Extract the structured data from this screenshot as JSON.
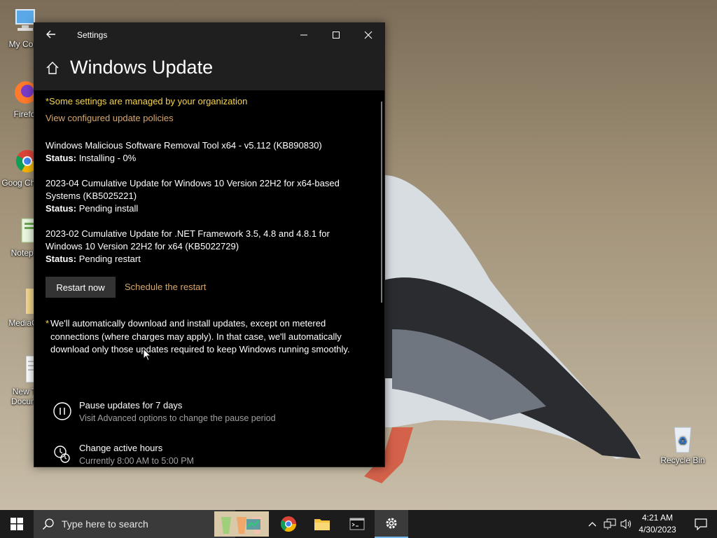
{
  "desktop": {
    "icons": [
      {
        "label": "My Com"
      },
      {
        "label": "Firefo"
      },
      {
        "label": "Goog Chron"
      },
      {
        "label": "Notepa"
      },
      {
        "label": "MediaCr"
      },
      {
        "label": "New T Docum"
      },
      {
        "label": "Recycle Bin"
      }
    ]
  },
  "window": {
    "title": "Settings",
    "heading": "Windows Update",
    "managed_notice": "*Some settings are managed by your organization",
    "policies_link": "View configured update policies",
    "updates": [
      {
        "name": "Windows Malicious Software Removal Tool x64 - v5.112 (KB890830)",
        "status_label": "Status:",
        "status": "Installing - 0%"
      },
      {
        "name": "2023-04 Cumulative Update for Windows 10 Version 22H2 for x64-based Systems (KB5025221)",
        "status_label": "Status:",
        "status": "Pending install"
      },
      {
        "name": "2023-02 Cumulative Update for .NET Framework 3.5, 4.8 and 4.8.1 for Windows 10 Version 22H2 for x64 (KB5022729)",
        "status_label": "Status:",
        "status": "Pending restart"
      }
    ],
    "restart_button": "Restart now",
    "schedule_link": "Schedule the restart",
    "note_star": "*",
    "note": "We'll automatically download and install updates, except on metered connections (where charges may apply). In that case, we'll automatically download only those updates required to keep Windows running smoothly.",
    "options": [
      {
        "title": "Pause updates for 7 days",
        "subtitle": "Visit Advanced options to change the pause period",
        "icon": "pause-icon"
      },
      {
        "title": "Change active hours",
        "subtitle": "Currently 8:00 AM to 5:00 PM",
        "icon": "clock-icon"
      }
    ]
  },
  "taskbar": {
    "search_placeholder": "Type here to search",
    "apps": [
      "task-manager",
      "chrome",
      "file-explorer",
      "command-prompt",
      "settings"
    ],
    "time": "4:21 AM",
    "date": "4/30/2023"
  },
  "colors": {
    "accent_yellow": "#f7d54a",
    "link": "#d9a86c",
    "window_bg": "#000000",
    "titlebar_bg": "#1f1f1f",
    "taskbar_bg": "#1c1c1c"
  }
}
